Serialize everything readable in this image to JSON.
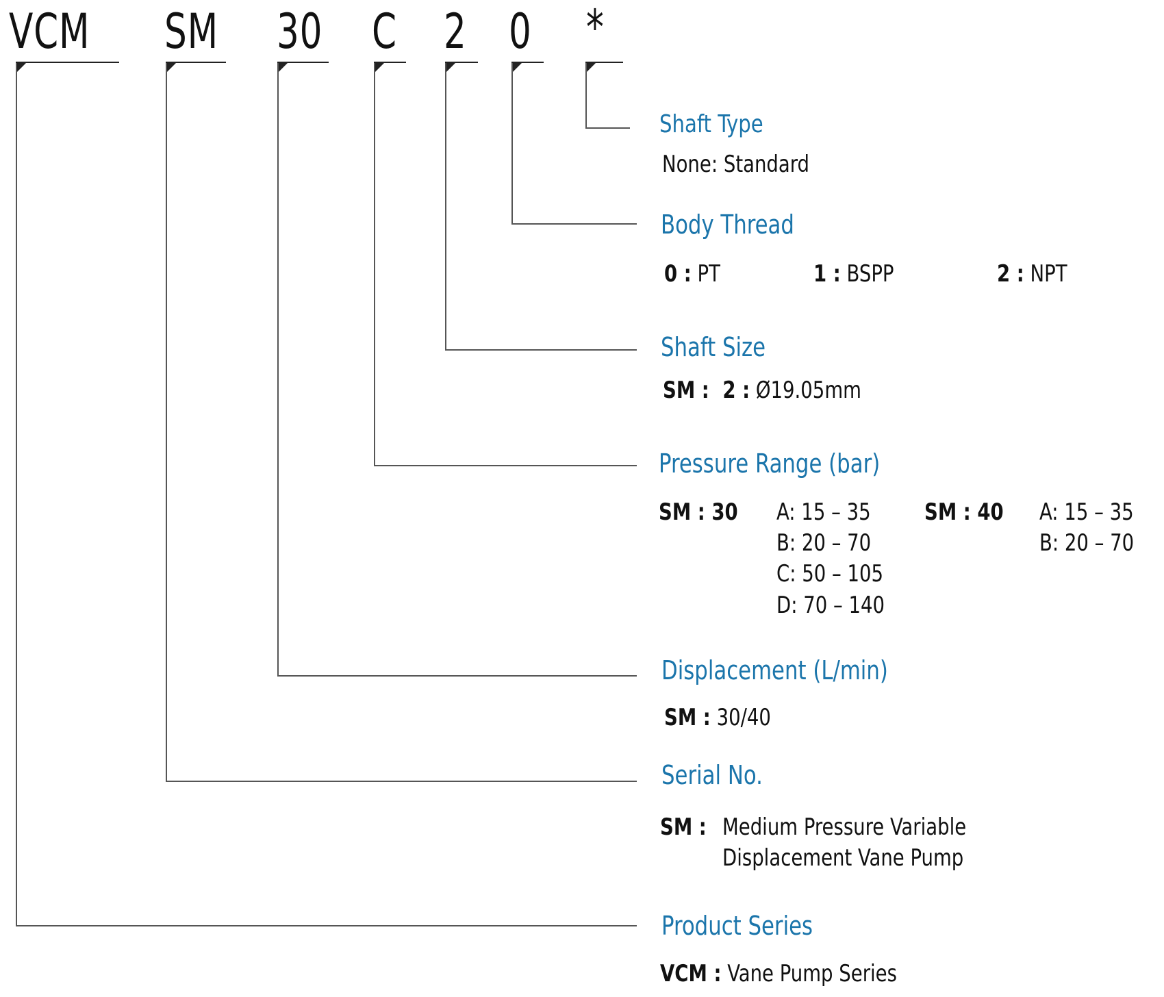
{
  "model_code": {
    "segments": [
      {
        "id": "series",
        "text": "VCM"
      },
      {
        "id": "serial",
        "text": "SM"
      },
      {
        "id": "displacement",
        "text": "30"
      },
      {
        "id": "pressure",
        "text": "C"
      },
      {
        "id": "shaft_size",
        "text": "2"
      },
      {
        "id": "body_thread",
        "text": "0"
      },
      {
        "id": "shaft_type",
        "text": "*"
      }
    ]
  },
  "sections": {
    "shaft_type": {
      "title": "Shaft Type",
      "text": "None: Standard"
    },
    "body_thread": {
      "title": "Body Thread",
      "options": [
        {
          "code": "0 :",
          "value": "PT"
        },
        {
          "code": "1 :",
          "value": "BSPP"
        },
        {
          "code": "2 :",
          "value": "NPT"
        }
      ]
    },
    "shaft_size": {
      "title": "Shaft Size",
      "series": "SM :",
      "code": "2 :",
      "value": "Ø19.05mm"
    },
    "pressure_range": {
      "title": "Pressure Range (bar)",
      "groups": [
        {
          "label": "SM : 30",
          "ranges": [
            "A: 15 – 35",
            "B: 20 – 70",
            "C: 50 – 105",
            "D: 70 – 140"
          ]
        },
        {
          "label": "SM : 40",
          "ranges": [
            "A: 15 – 35",
            "B: 20 – 70"
          ]
        }
      ]
    },
    "displacement": {
      "title": "Displacement (L/min)",
      "series": "SM :",
      "value": "30/40"
    },
    "serial_no": {
      "title": "Serial No.",
      "series": "SM :",
      "lines": [
        "Medium Pressure Variable",
        "Displacement Vane Pump"
      ]
    },
    "product_series": {
      "title": "Product Series",
      "series": "VCM :",
      "value": "Vane Pump Series"
    }
  },
  "colors": {
    "heading": "#1b75ab",
    "text": "#111111",
    "lines": "#555555"
  }
}
